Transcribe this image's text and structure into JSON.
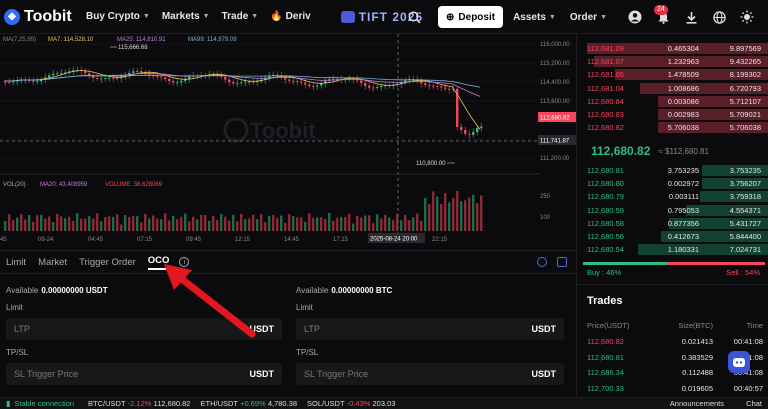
{
  "header": {
    "brand": "Toobit",
    "nav": [
      "Buy Crypto",
      "Markets",
      "Trade",
      "Deriv"
    ],
    "promo": "TIFT 2025",
    "deposit": "Deposit",
    "assets": "Assets",
    "order": "Order",
    "notif_count": "24"
  },
  "chart": {
    "ma_legend": {
      "ma1": "MA(7,25,99)",
      "ma7": "MA7: 114,528.10",
      "ma25": "MA25: 114,810.91",
      "ma99": "MA99: 114,979.09"
    },
    "high_label": "115,666.68",
    "low_label": "110,800.00",
    "watermark": "Toobit",
    "y_ticks": [
      "116,000.00",
      "115,200.00",
      "114,400.00",
      "113,600.00",
      "112,800.00",
      "112,000.00",
      "111,200.00"
    ],
    "last_price": "112,680.82",
    "cross_price": "111,741.87",
    "vol_legend": {
      "vol": "VOL(20)",
      "ma20": "MA20: 43.408959",
      "volume": "VOLUME: 38.628069"
    },
    "vol_ticks": [
      "250",
      "100"
    ],
    "x_ticks": [
      "45",
      "08-24",
      "04:45",
      "07:15",
      "09:45",
      "12:15",
      "14:45",
      "17:15",
      "2025-08-24 20:00",
      "22:15"
    ],
    "colors": {
      "up": "#2ebd85",
      "down": "#f6465d",
      "ma7": "#e6c35a",
      "ma25": "#c77be0",
      "ma99": "#6fb7d6"
    }
  },
  "orderbook": {
    "asks": [
      {
        "price": "112,681.09",
        "amount": "0.465304",
        "total": "9.897569",
        "depth": 0.95
      },
      {
        "price": "112,681.07",
        "amount": "1.232963",
        "total": "9.432265",
        "depth": 0.91
      },
      {
        "price": "112,681.05",
        "amount": "1.478509",
        "total": "8.199302",
        "depth": 0.8
      },
      {
        "price": "112,681.04",
        "amount": "1.008686",
        "total": "6.720793",
        "depth": 0.67
      },
      {
        "price": "112,680.84",
        "amount": "0.003086",
        "total": "5.712107",
        "depth": 0.58
      },
      {
        "price": "112,680.83",
        "amount": "0.002983",
        "total": "5.709021",
        "depth": 0.58
      },
      {
        "price": "112,680.82",
        "amount": "5.706038",
        "total": "5.706038",
        "depth": 0.58
      }
    ],
    "mid_price": "112,680.82",
    "mid_usd": "≈ $112,680.81",
    "bids": [
      {
        "price": "112,680.81",
        "amount": "3.753235",
        "total": "3.753235",
        "depth": 0.35
      },
      {
        "price": "112,680.80",
        "amount": "0.002972",
        "total": "3.756207",
        "depth": 0.35
      },
      {
        "price": "112,680.79",
        "amount": "0.003111",
        "total": "3.759318",
        "depth": 0.36
      },
      {
        "price": "112,680.59",
        "amount": "0.795053",
        "total": "4.554371",
        "depth": 0.43
      },
      {
        "price": "112,680.58",
        "amount": "0.877356",
        "total": "5.431727",
        "depth": 0.52
      },
      {
        "price": "112,680.56",
        "amount": "0.412673",
        "total": "5.844400",
        "depth": 0.56
      },
      {
        "price": "112,680.54",
        "amount": "1.180331",
        "total": "7.024731",
        "depth": 0.68
      }
    ],
    "buy_label": "Buy : 46%",
    "sell_label": "Sell : 54%",
    "buy_ratio": 0.46
  },
  "tabs": {
    "items": [
      "Limit",
      "Market",
      "Trigger Order",
      "OCO"
    ],
    "active": "OCO"
  },
  "form": {
    "left": {
      "avail_label": "Available",
      "avail_value": "0.00000000 USDT",
      "limit_label": "Limit",
      "limit_ph": "LTP",
      "limit_unit": "USDT",
      "tpsl_label": "TP/SL",
      "tpsl_ph": "SL Trigger Price",
      "tpsl_unit": "USDT"
    },
    "right": {
      "avail_label": "Available",
      "avail_value": "0.00000000 BTC",
      "limit_label": "Limit",
      "limit_ph": "LTP",
      "limit_unit": "USDT",
      "tpsl_label": "TP/SL",
      "tpsl_ph": "SL Trigger Price",
      "tpsl_unit": "USDT"
    }
  },
  "trades": {
    "title": "Trades",
    "cols": [
      "Price(USDT)",
      "Size(BTC)",
      "Time"
    ],
    "rows": [
      {
        "price": "112,680.82",
        "size": "0.021413",
        "time": "00:41:08",
        "side": "sell"
      },
      {
        "price": "112,680.81",
        "size": "0.383529",
        "time": "00:41:08",
        "side": "buy"
      },
      {
        "price": "112,686.34",
        "size": "0.112488",
        "time": "00:41:08",
        "side": "buy"
      },
      {
        "price": "112,700.33",
        "size": "0.019605",
        "time": "00:40:57",
        "side": "buy"
      }
    ]
  },
  "footer": {
    "status": "Stable connection",
    "tickers": [
      {
        "pair": "BTC/USDT",
        "change": "-2.12%",
        "price": "112,680.82",
        "dir": "down"
      },
      {
        "pair": "ETH/USDT",
        "change": "+0.69%",
        "price": "4,780.38",
        "dir": "up"
      },
      {
        "pair": "SOL/USDT",
        "change": "-0.43%",
        "price": "203.03",
        "dir": "down"
      }
    ],
    "announcements": "Announcements",
    "chat": "Chat"
  }
}
